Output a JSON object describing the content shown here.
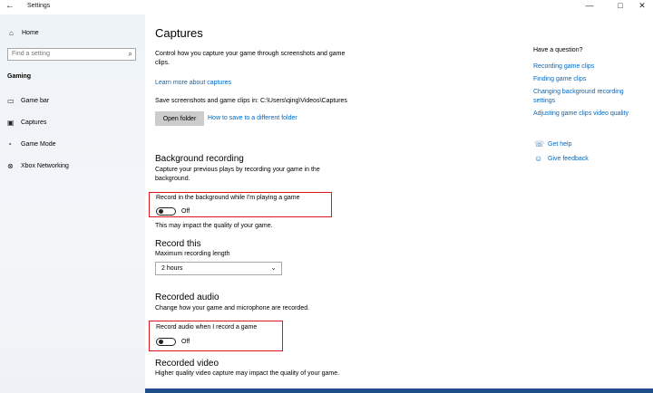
{
  "window": {
    "title": "Settings",
    "back_glyph": "←",
    "minimize_glyph": "—",
    "maximize_glyph": "□",
    "close_glyph": "✕"
  },
  "sidebar": {
    "home_label": "Home",
    "search_placeholder": "Find a setting",
    "section_title": "Gaming",
    "items": [
      {
        "label": "Game bar",
        "icon": "game-bar-icon",
        "glyph": "▭"
      },
      {
        "label": "Captures",
        "icon": "captures-icon",
        "glyph": "▣"
      },
      {
        "label": "Game Mode",
        "icon": "game-mode-icon",
        "glyph": "◔"
      },
      {
        "label": "Xbox Networking",
        "icon": "xbox-icon",
        "glyph": "⊗"
      }
    ]
  },
  "main": {
    "title": "Captures",
    "intro": "Control how you capture your game through screenshots and game clips.",
    "learn_more": "Learn more about captures",
    "save_path": "Save screenshots and game clips in: C:\\Users\\qing\\Videos\\Captures",
    "open_folder": "Open folder",
    "how_to_save": "How to save to a different folder",
    "background": {
      "heading": "Background recording",
      "desc": "Capture your previous plays by recording your game in the background.",
      "toggle_label": "Record in the background while I'm playing a game",
      "toggle_state": "Off",
      "note": "This may impact the quality of your game."
    },
    "record_this": {
      "heading": "Record this",
      "label": "Maximum recording length",
      "value": "2 hours"
    },
    "audio": {
      "heading": "Recorded audio",
      "desc": "Change how your game and microphone are recorded.",
      "toggle_label": "Record audio when I record a game",
      "toggle_state": "Off"
    },
    "video": {
      "heading": "Recorded video",
      "desc": "Higher quality video capture may impact the quality of your game."
    }
  },
  "right": {
    "question": "Have a question?",
    "links": [
      "Recording game clips",
      "Finding game clips",
      "Changing background recording settings",
      "Adjusting game clips video quality"
    ],
    "get_help": "Get help",
    "give_feedback": "Give feedback"
  },
  "colors": {
    "link": "#0067c0",
    "highlight": "#e0141c",
    "button_bg": "#cccccc"
  }
}
